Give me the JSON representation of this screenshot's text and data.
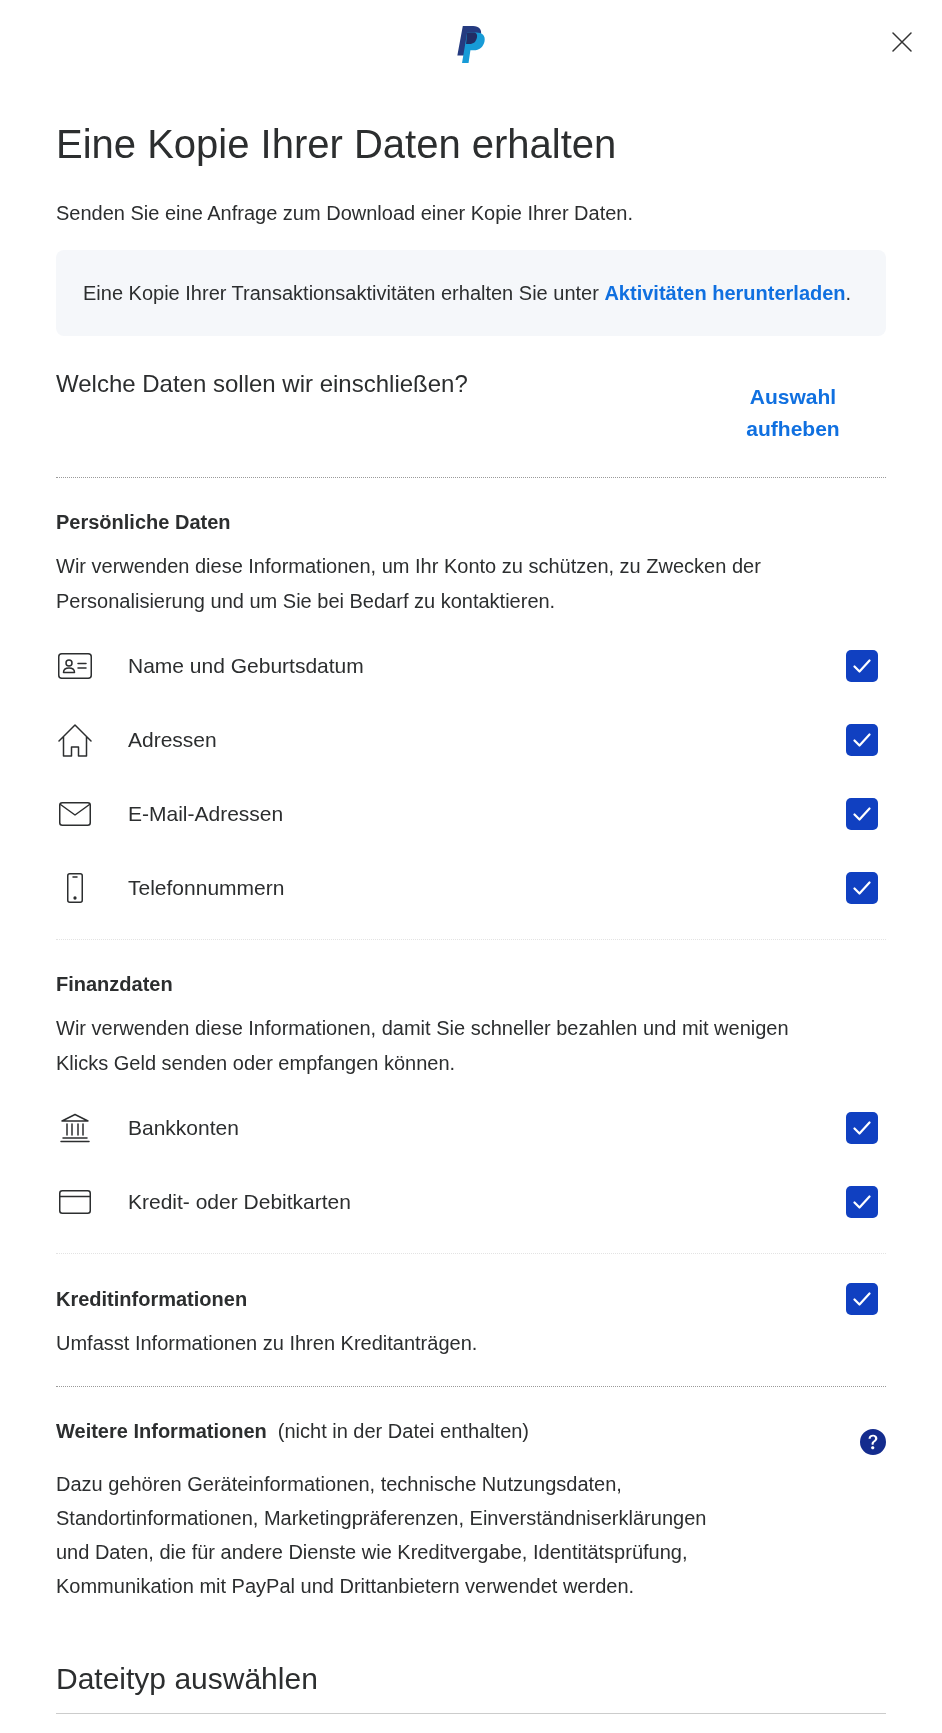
{
  "title": "Eine Kopie Ihrer Daten erhalten",
  "subtitle": "Senden Sie eine Anfrage zum Download einer Kopie Ihrer Daten.",
  "notice": {
    "text": "Eine Kopie Ihrer Transaktionsaktivitäten erhalten Sie unter",
    "link": "Aktivitäten herunterladen",
    "end": "."
  },
  "selection": {
    "question": "Welche Daten sollen wir einschließen?",
    "clear_link": "Auswahl aufheben"
  },
  "categories": [
    {
      "kind": "group",
      "title": "Persönliche Daten",
      "description": "Wir verwenden diese Informationen, um Ihr Konto zu schützen, zu Zwecken der Personalisierung und um Sie bei Bedarf zu kontaktieren.",
      "items": [
        {
          "kind": "id_card",
          "label": "Name und Geburtsdatum",
          "checked": true
        },
        {
          "kind": "address",
          "label": "Adressen",
          "checked": true
        },
        {
          "kind": "email",
          "label": "E-Mail-Adressen",
          "checked": true
        },
        {
          "kind": "phone",
          "label": "Telefonnummern",
          "checked": true
        }
      ]
    },
    {
      "kind": "group",
      "title": "Finanzdaten",
      "description": "Wir verwenden diese Informationen, damit Sie schneller bezahlen und mit wenigen Klicks Geld senden oder empfangen können.",
      "items": [
        {
          "kind": "bank",
          "label": "Bankkonten",
          "checked": true
        },
        {
          "kind": "card",
          "label": "Kredit- oder Debitkarten",
          "checked": true
        }
      ]
    },
    {
      "kind": "single",
      "title": "Kreditinformationen",
      "description": "Umfasst Informationen zu Ihren Kreditanträgen.",
      "checked": true
    },
    {
      "kind": "info",
      "title": "Weitere Informationen",
      "note": "(nicht in der Datei enthalten)",
      "description": "Dazu gehören Geräteinformationen, technische Nutzungsdaten, Standortinformationen, Marketingpräferenzen, Einverständniserklärungen und Daten, die für andere Dienste wie Kreditvergabe, Identitätsprüfung, Kommunikation mit PayPal und Drittanbietern verwendet werden."
    }
  ],
  "file_type": {
    "title": "Dateityp auswählen"
  }
}
